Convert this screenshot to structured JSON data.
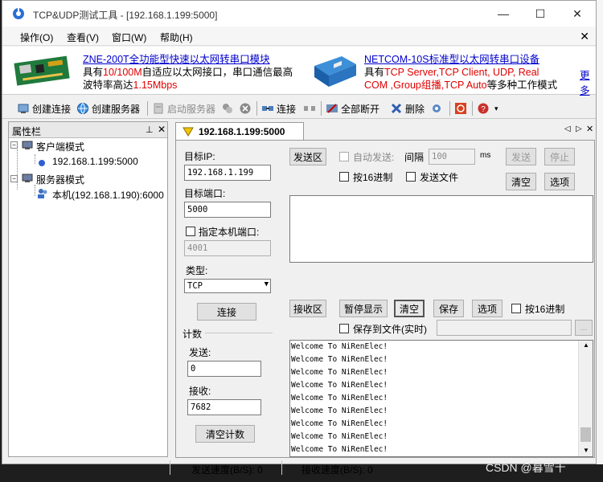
{
  "window": {
    "title": "TCP&UDP测试工具 - [192.168.1.199:5000]",
    "min_glyph": "—",
    "max_glyph": "☐",
    "close_glyph": "✕"
  },
  "menu": {
    "items": [
      "操作(O)",
      "查看(V)",
      "窗口(W)",
      "帮助(H)"
    ],
    "close": "✕"
  },
  "banner": {
    "ad1": {
      "title": "ZNE-200T全功能型快速以太网转串口模块",
      "line2_a": "具有",
      "line2_red": "10/100M",
      "line2_b": "自适应以太网接口，串口通信最高",
      "line3_a": "波特率高达",
      "line3_red": "1.15Mbps"
    },
    "ad2": {
      "title": "NETCOM-10S标准型以太网转串口设备",
      "line2_a": "具有",
      "line2_red": "TCP Server,TCP Client, UDP, Real",
      "line3_red": "COM ,Group组播,TCP Auto",
      "line3_b": "等多种工作模式"
    },
    "more": "更多"
  },
  "toolbar": {
    "create_conn": "创建连接",
    "create_server": "创建服务器",
    "start_server": "启动服务器",
    "connect": "连接",
    "disconnect_all": "全部断开",
    "delete": "删除"
  },
  "side_pane": {
    "title": "属性栏",
    "pin": "⊥",
    "close": "✕",
    "client_mode": "客户端模式",
    "client_entry": "192.168.1.199:5000",
    "server_mode": "服务器模式",
    "server_entry": "本机(192.168.1.190):6000"
  },
  "tab": {
    "label": "192.168.1.199:5000",
    "nav_left": "◁",
    "nav_right": "▷",
    "close": "✕"
  },
  "connection": {
    "target_ip_label": "目标IP:",
    "target_ip": "192.168.1.199",
    "target_port_label": "目标端口:",
    "target_port": "5000",
    "local_port_label": "指定本机端口:",
    "local_port": "4001",
    "type_label": "类型:",
    "type_value": "TCP",
    "connect_button": "连接"
  },
  "counter": {
    "title": "计数",
    "send_label": "发送:",
    "send_value": "0",
    "recv_label": "接收:",
    "recv_value": "7682",
    "clear_button": "清空计数"
  },
  "send_area": {
    "label": "发送区",
    "auto_send": "自动发送:",
    "interval_label": "间隔",
    "interval_value": "100",
    "interval_unit": "ms",
    "send_button": "发送",
    "stop_button": "停止",
    "hex_label": "按16进制",
    "send_file_label": "发送文件",
    "clear_button": "清空",
    "options_button": "选项"
  },
  "recv_area": {
    "label": "接收区",
    "pause_button": "暂停显示",
    "clear_button": "清空",
    "save_button": "保存",
    "options_button": "选项",
    "hex_label": "按16进制",
    "save_to_file_label": "保存到文件(实时)",
    "browse_button": "...",
    "lines": [
      "Welcome To NiRenElec!",
      "Welcome To NiRenElec!",
      "Welcome To NiRenElec!",
      "Welcome To NiRenElec!",
      "Welcome To NiRenElec!",
      "Welcome To NiRenElec!",
      "Welcome To NiRenElec!",
      "Welcome To NiRenElec!",
      "Welcome To NiRenElec!"
    ]
  },
  "status": {
    "send_speed": "发送速度(B/S): 0",
    "recv_speed": "接收速度(B/S): 0"
  },
  "watermark": "CSDN @暮雪千"
}
